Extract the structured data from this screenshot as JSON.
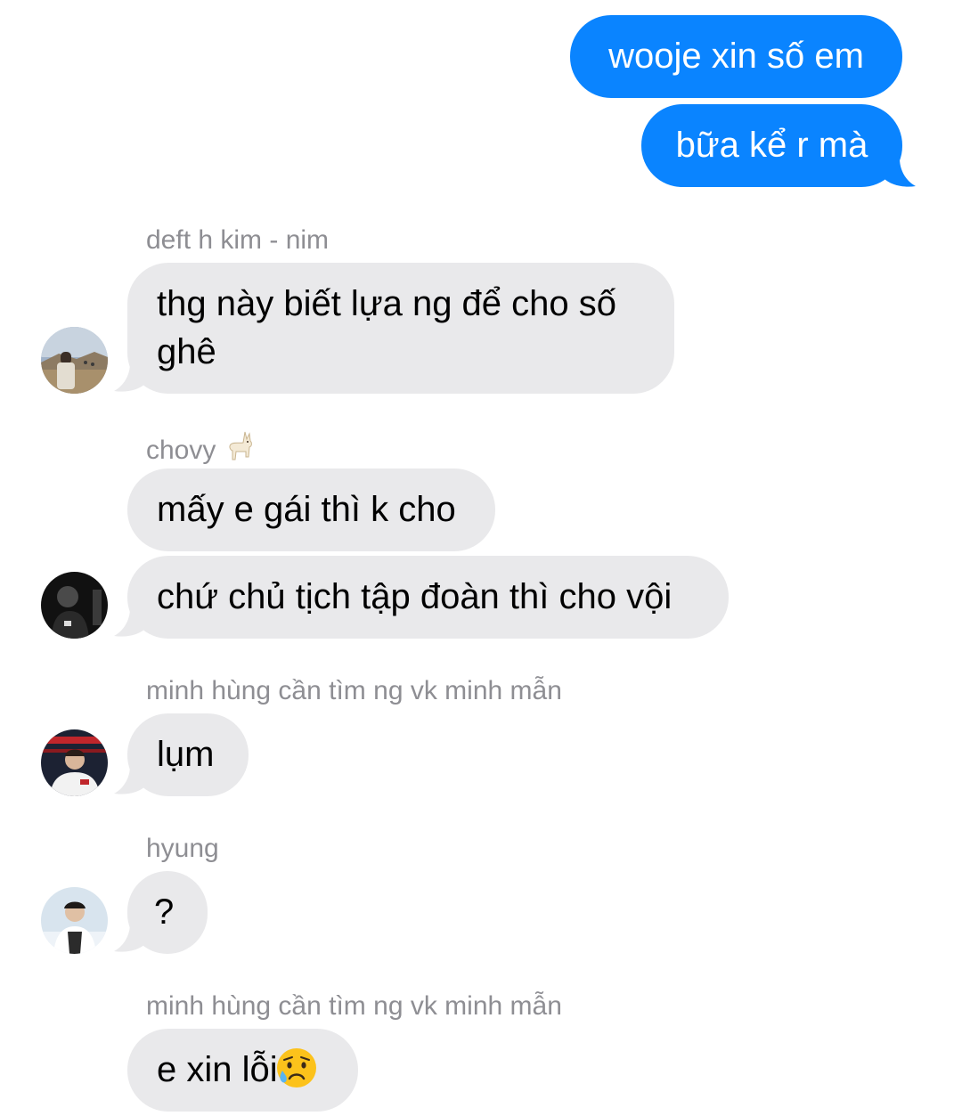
{
  "colors": {
    "outgoing_bubble": "#0a84ff",
    "incoming_bubble": "#e9e9eb",
    "sender_name": "#8e8e93"
  },
  "outgoing": [
    {
      "text": "wooje xin số em"
    },
    {
      "text": "bữa kể r mà"
    }
  ],
  "incoming": [
    {
      "sender": "deft h kim - nim",
      "sender_emoji": "",
      "avatar_icon": "avatar-photo-deft",
      "messages": [
        {
          "line1": "thg này biết lựa ng để cho số",
          "line2": "ghê"
        }
      ]
    },
    {
      "sender": "chovy",
      "sender_emoji": "llama-emoji",
      "avatar_icon": "avatar-photo-chovy",
      "messages": [
        {
          "text": "mấy e gái thì k cho"
        },
        {
          "text": "chứ chủ tịch tập đoàn thì cho vội"
        }
      ]
    },
    {
      "sender": "minh hùng cần tìm ng vk minh mẫn",
      "sender_emoji": "",
      "avatar_icon": "avatar-photo-minh-hung",
      "messages": [
        {
          "text": "lụm"
        }
      ]
    },
    {
      "sender": "hyung",
      "sender_emoji": "",
      "avatar_icon": "avatar-photo-hyung",
      "messages": [
        {
          "text": "?"
        }
      ]
    },
    {
      "sender": "minh hùng cần tìm ng vk minh mẫn",
      "sender_emoji": "",
      "avatar_icon": "",
      "messages": [
        {
          "text": "e xin lỗi",
          "emoji": "sad-but-relieved-face-emoji"
        }
      ]
    }
  ]
}
